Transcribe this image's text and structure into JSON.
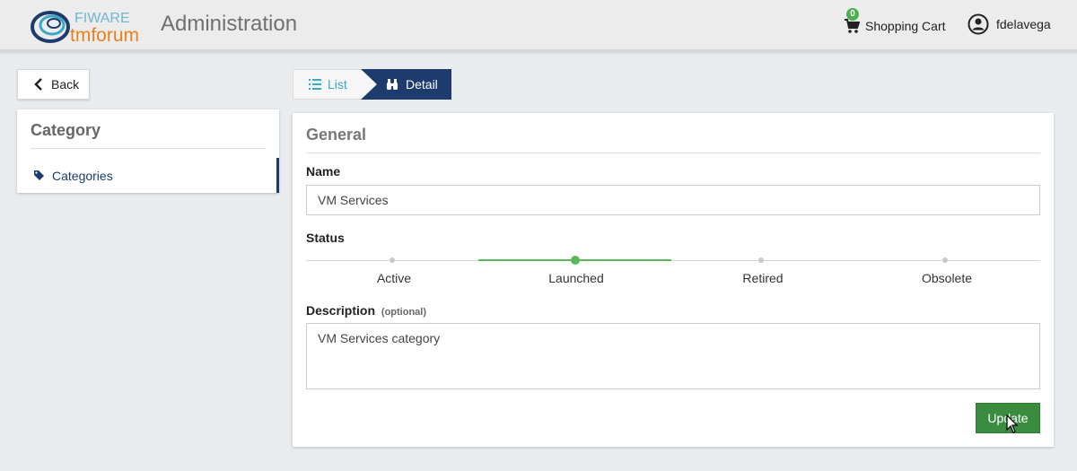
{
  "header": {
    "logo": {
      "name": "fiware-tmforum-logo",
      "text_top": "FIWARE",
      "text_bottom": "tmforum"
    },
    "title": "Administration",
    "cart": {
      "label": "Shopping Cart",
      "count": "0"
    },
    "user": {
      "name": "fdelavega"
    }
  },
  "sidebar": {
    "back_label": "Back",
    "panel_title": "Category",
    "items": [
      {
        "label": "Categories",
        "icon": "tag-icon"
      }
    ]
  },
  "tabs": [
    {
      "label": "List",
      "icon": "list-icon",
      "active": false
    },
    {
      "label": "Detail",
      "icon": "binoculars-icon",
      "active": true
    }
  ],
  "form": {
    "section_title": "General",
    "name_label": "Name",
    "name_value": "VM Services",
    "status_label": "Status",
    "statuses": [
      "Active",
      "Launched",
      "Retired",
      "Obsolete"
    ],
    "current_status": "Launched",
    "description_label": "Description",
    "description_optional": "(optional)",
    "description_value": "VM Services category",
    "update_label": "Update"
  },
  "colors": {
    "brand_navy": "#1d3c6d",
    "accent_teal": "#3aa8c4",
    "success_green": "#5cb85c",
    "button_green": "#3a8d3e"
  }
}
